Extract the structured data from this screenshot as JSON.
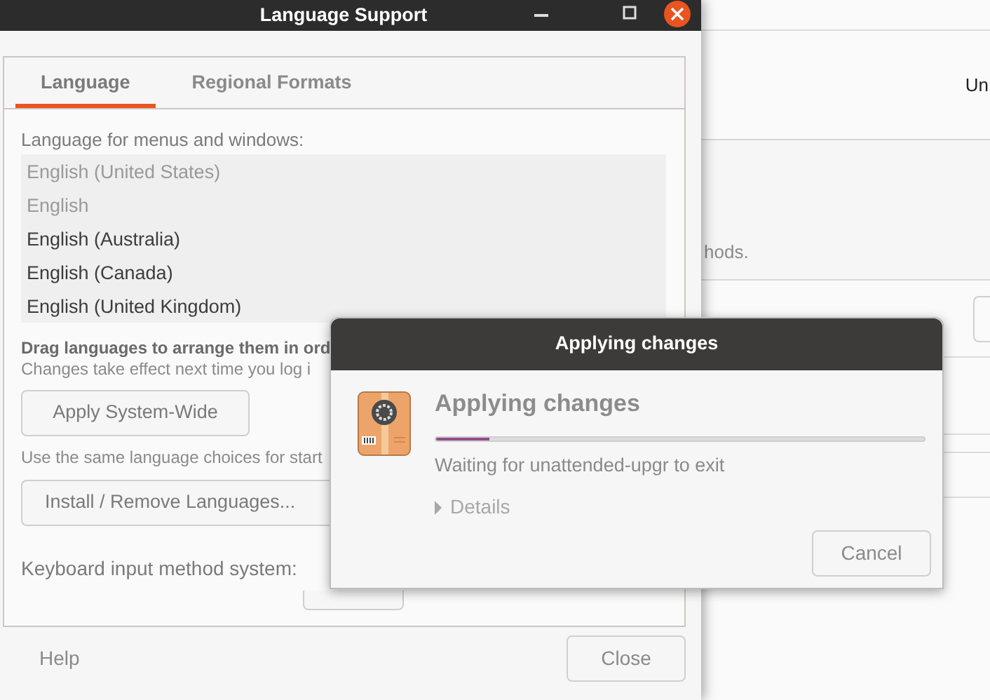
{
  "background_window": {
    "texts": [
      "Un",
      "hods."
    ]
  },
  "window": {
    "title": "Language Support",
    "tabs": [
      {
        "label": "Language",
        "selected": true
      },
      {
        "label": "Regional Formats",
        "selected": false
      }
    ],
    "language_label": "Language for menus and windows:",
    "languages": [
      {
        "name": "English (United States)",
        "dimmed": true
      },
      {
        "name": "English",
        "dimmed": true
      },
      {
        "name": "English (Australia)",
        "dimmed": false
      },
      {
        "name": "English (Canada)",
        "dimmed": false
      },
      {
        "name": "English (United Kingdom)",
        "dimmed": false
      }
    ],
    "hint_bold": "Drag languages to arrange them in ord",
    "hint": "Changes take effect next time you log i",
    "apply_button": "Apply System-Wide",
    "apply_note": "Use the same language choices for start",
    "install_button": "Install / Remove Languages...",
    "keyboard_label": "Keyboard input method system:",
    "help": "Help",
    "close_button": "Close"
  },
  "dialog": {
    "title": "Applying changes",
    "heading": "Applying changes",
    "progress": {
      "level": 0.11
    },
    "status": "Waiting for unattended-upgr to exit",
    "details": {
      "label": "Details",
      "expanded": false,
      "disabled": true
    },
    "cancel_button": "Cancel"
  }
}
